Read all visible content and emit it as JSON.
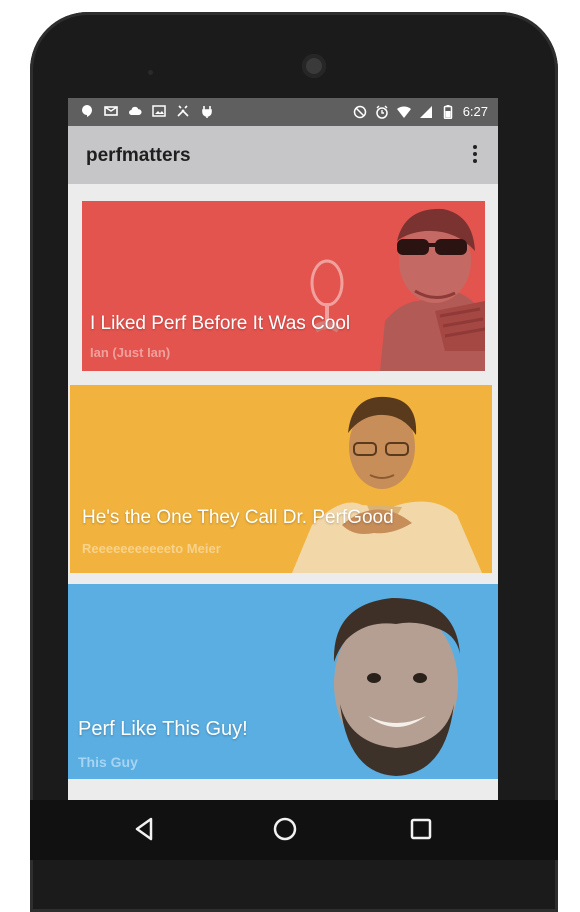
{
  "status_bar": {
    "time": "6:27",
    "left_icons": [
      "hangouts-icon",
      "mail-icon",
      "cloud-icon",
      "gallery-icon",
      "tools-icon",
      "plug-icon"
    ],
    "right_icons": [
      "do-not-disturb-icon",
      "alarm-icon",
      "wifi-icon",
      "signal-icon",
      "battery-icon"
    ]
  },
  "app_bar": {
    "title": "perfmatters",
    "menu_icon": "overflow-menu-icon"
  },
  "cards": [
    {
      "title": "I Liked Perf Before It Was Cool",
      "subtitle": "Ian (Just Ian)",
      "color": "#e4544f",
      "subtitle_color": "#f0a09c"
    },
    {
      "title": "He's the One They Call Dr. PerfGood",
      "subtitle": "Reeeeeeeeeeeto Meier",
      "color": "#f1b33d",
      "subtitle_color": "#f7d28c"
    },
    {
      "title": "Perf Like This Guy!",
      "subtitle": "This Guy",
      "color": "#5aaee2",
      "subtitle_color": "#a6d4f1"
    }
  ],
  "nav_bar": {
    "back_icon": "back-icon",
    "home_icon": "home-icon",
    "recents_icon": "recents-icon"
  }
}
